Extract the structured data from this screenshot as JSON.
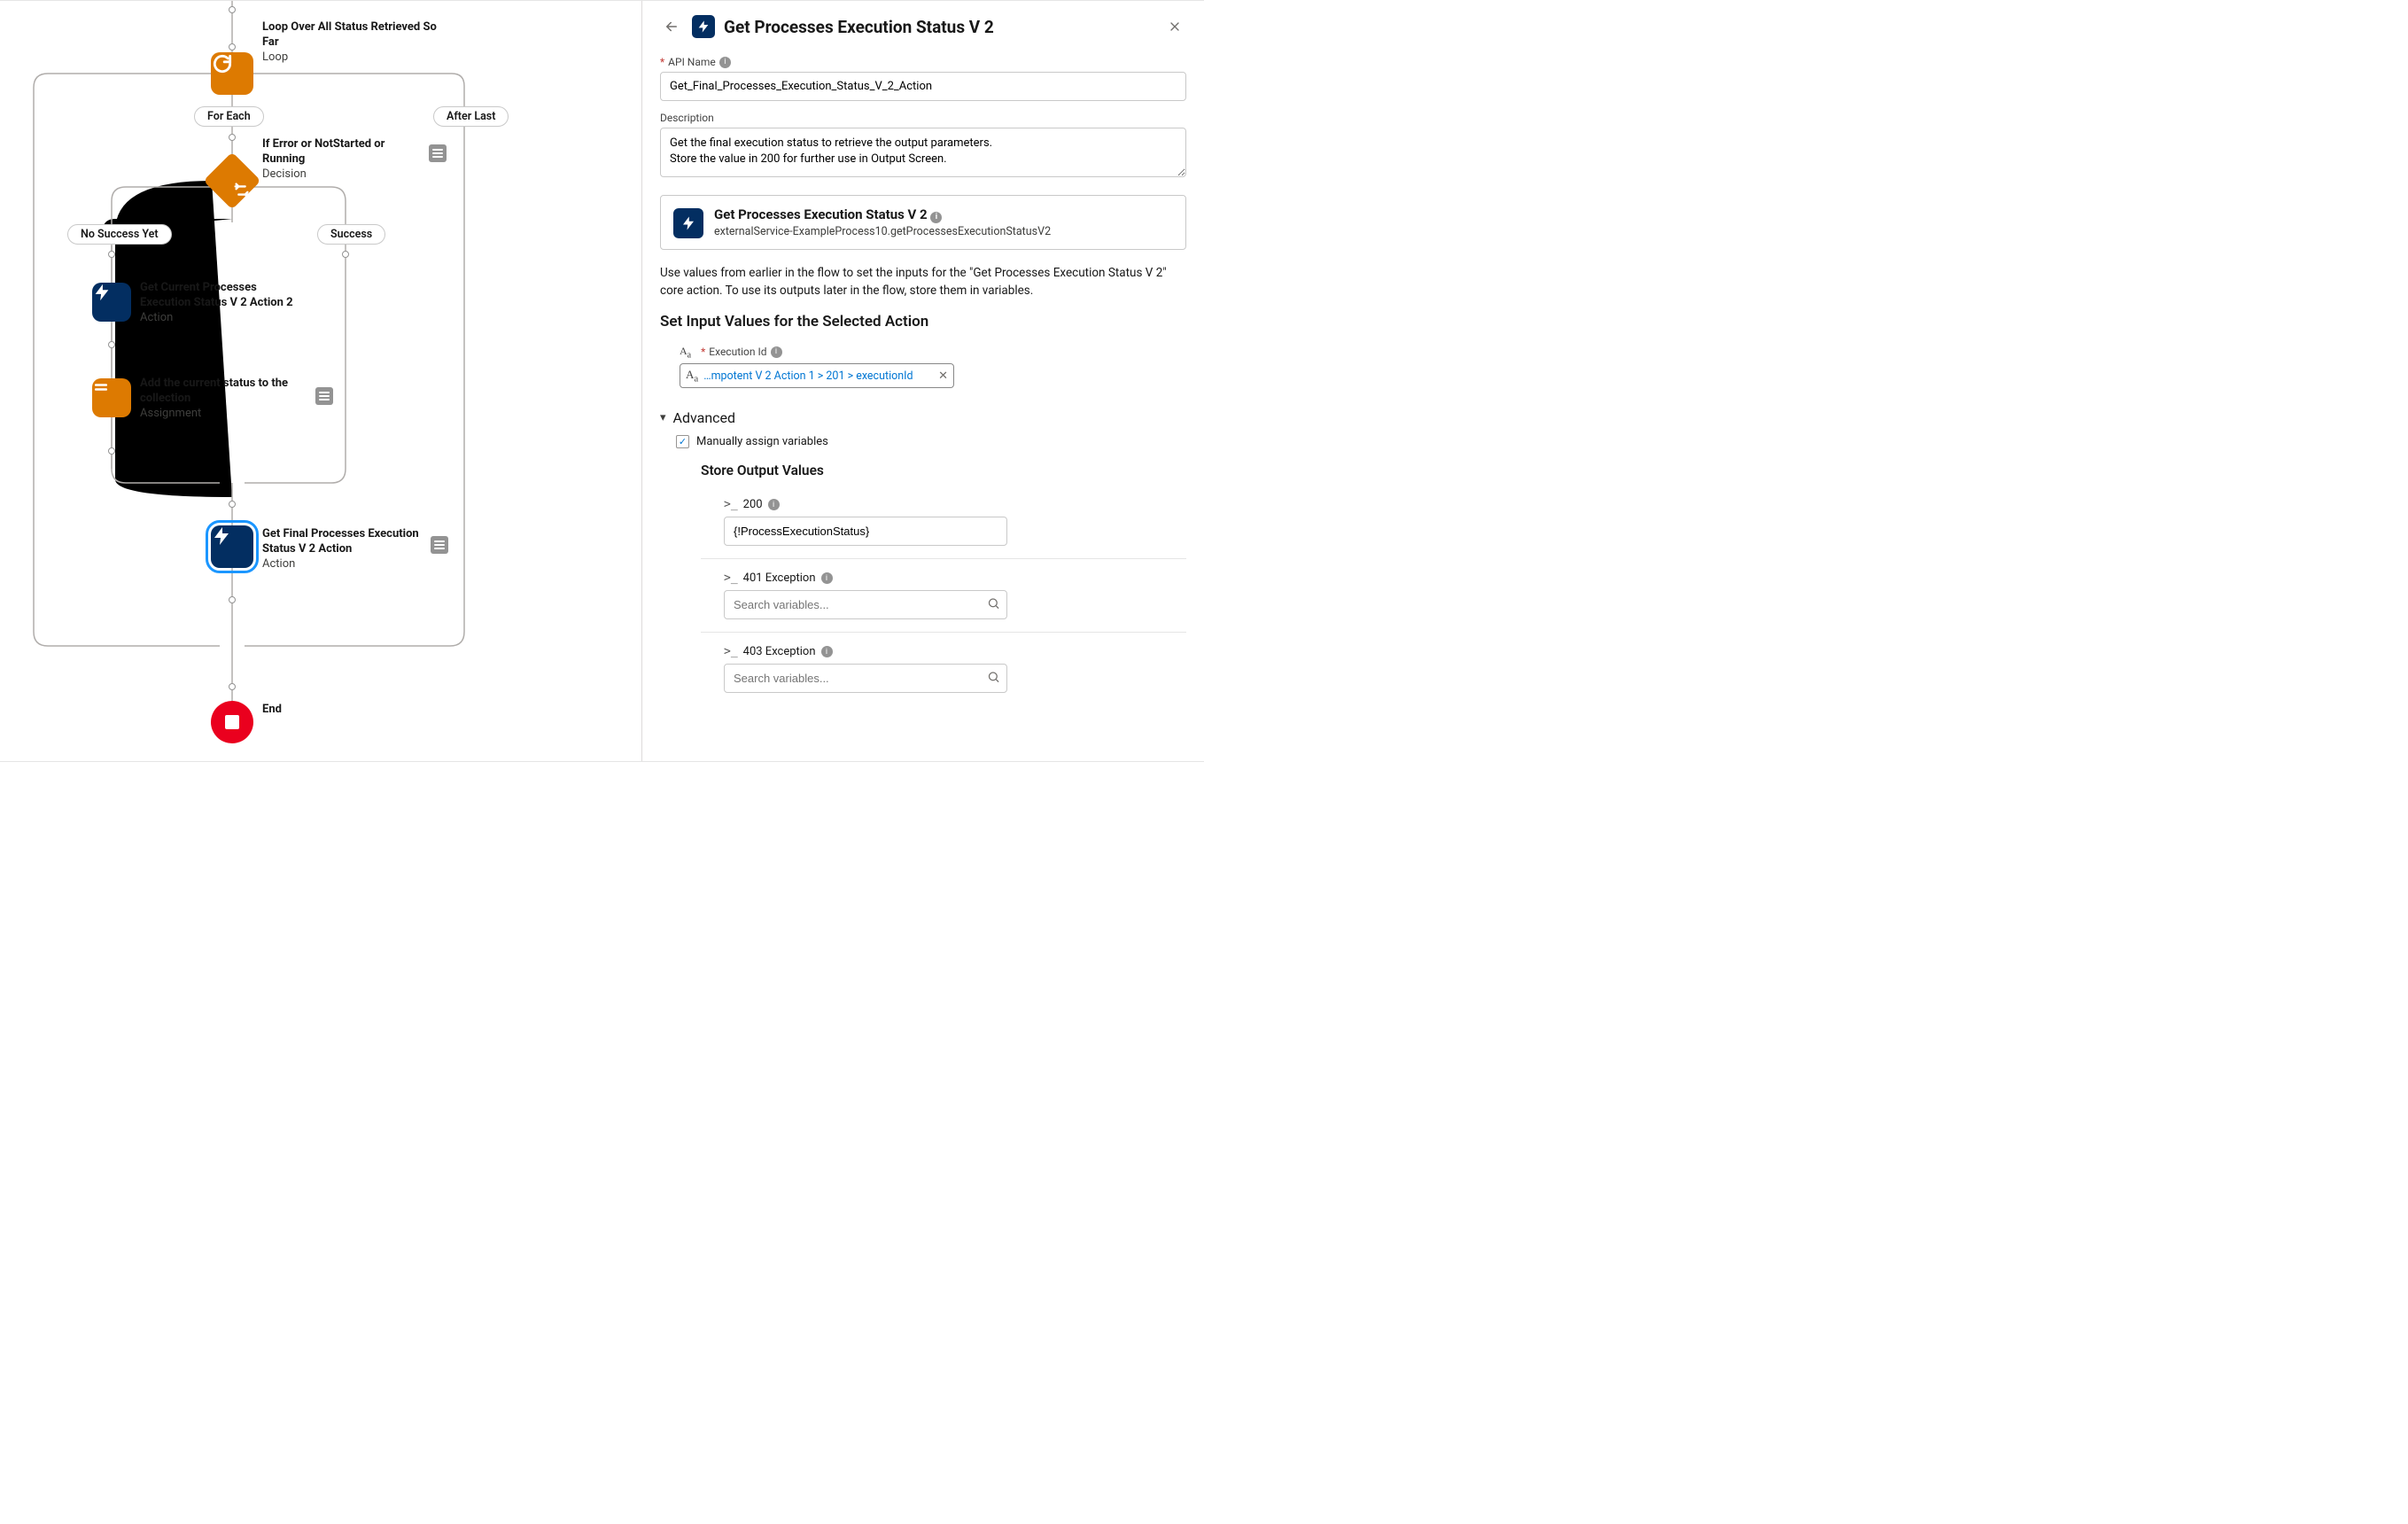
{
  "flow": {
    "loop": {
      "title": "Loop Over All Status Retrieved So Far",
      "type": "Loop"
    },
    "forEachLabel": "For Each",
    "afterLastLabel": "After Last",
    "decision": {
      "title": "If Error or NotStarted or Running",
      "type": "Decision"
    },
    "noSuccessLabel": "No Success Yet",
    "successLabel": "Success",
    "action1": {
      "title": "Get Current Processes Execution Status V 2 Action 2",
      "type": "Action"
    },
    "assignment": {
      "title": "Add the current status to the collection",
      "type": "Assignment"
    },
    "action2": {
      "title": "Get Final Processes Execution Status V 2 Action",
      "type": "Action"
    },
    "end": {
      "title": "End"
    }
  },
  "panel": {
    "title": "Get Processes Execution Status V 2",
    "apiNameLabel": "API Name",
    "apiNameValue": "Get_Final_Processes_Execution_Status_V_2_Action",
    "descriptionLabel": "Description",
    "descriptionValue": "Get the final execution status to retrieve the output parameters.\nStore the value in 200 for further use in Output Screen.",
    "actionCard": {
      "title": "Get Processes Execution Status V 2",
      "subtitle": "externalService-ExampleProcess10.getProcessesExecutionStatusV2"
    },
    "helpText": "Use values from earlier in the flow to set the inputs for the \"Get Processes Execution Status V 2\" core action. To use its outputs later in the flow, store them in variables.",
    "inputsTitle": "Set Input Values for the Selected Action",
    "executionIdLabel": "Execution Id",
    "executionIdValue": "…mpotent V 2 Action 1 > 201 > executionId",
    "advancedLabel": "Advanced",
    "manualAssignLabel": "Manually assign variables",
    "storeOutputsTitle": "Store Output Values",
    "outputs": [
      {
        "label": "200",
        "value": "{!ProcessExecutionStatus}",
        "placeholder": ""
      },
      {
        "label": "401 Exception",
        "value": "",
        "placeholder": "Search variables..."
      },
      {
        "label": "403 Exception",
        "value": "",
        "placeholder": "Search variables..."
      }
    ]
  }
}
